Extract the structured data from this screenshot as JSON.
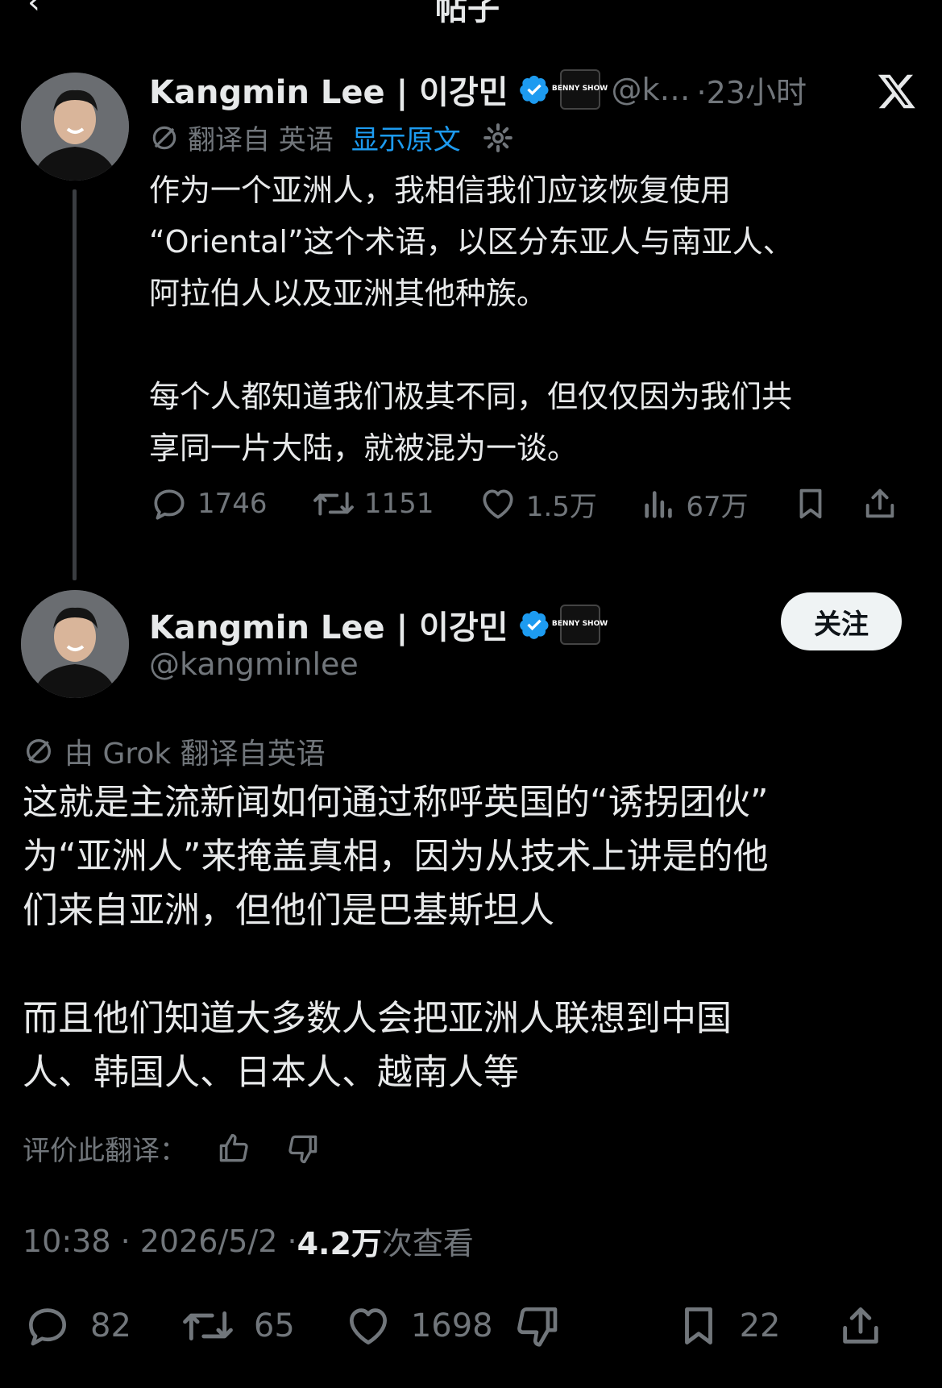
{
  "header": {
    "title": "帖子"
  },
  "tweet1": {
    "author_name": "Kangmin Lee | 이강민",
    "badge_text": "BENNY SHOW",
    "handle_short": "@k…",
    "time": "·23小时",
    "translate_from": "翻译自 英语",
    "show_original": "显示原文",
    "text": "作为一个亚洲人，我相信我们应该恢复使用\n“Oriental”这个术语，以区分东亚人与南亚人、\n阿拉伯人以及亚洲其他种族。\n\n每个人都知道我们极其不同，但仅仅因为我们共\n享同一片大陆，就被混为一谈。",
    "replies": "1746",
    "retweets": "1151",
    "likes": "1.5万",
    "views": "67万"
  },
  "tweet2": {
    "author_name": "Kangmin Lee | 이강민",
    "badge_text": "BENNY SHOW",
    "handle": "@kangminlee",
    "follow_label": "关注",
    "translate_note": "由 Grok 翻译自英语",
    "text": "这就是主流新闻如何通过称呼英国的“诱拐团伙”\n为“亚洲人”来掩盖真相，因为从技术上讲是的他\n们来自亚洲，但他们是巴基斯坦人\n\n而且他们知道大多数人会把亚洲人联想到中国\n人、韩国人、日本人、越南人等",
    "rate_translation": "评价此翻译：",
    "timestamp": "10:38 · 2026/5/2 · ",
    "view_count": "4.2万",
    "view_label": " 次查看",
    "replies": "82",
    "retweets": "65",
    "likes": "1698",
    "bookmarks": "22"
  },
  "colors": {
    "background": "#000000",
    "text": "#e7e9ea",
    "muted": "#71767b",
    "link": "#1d9bf0",
    "verified": "#1d9bf0"
  }
}
